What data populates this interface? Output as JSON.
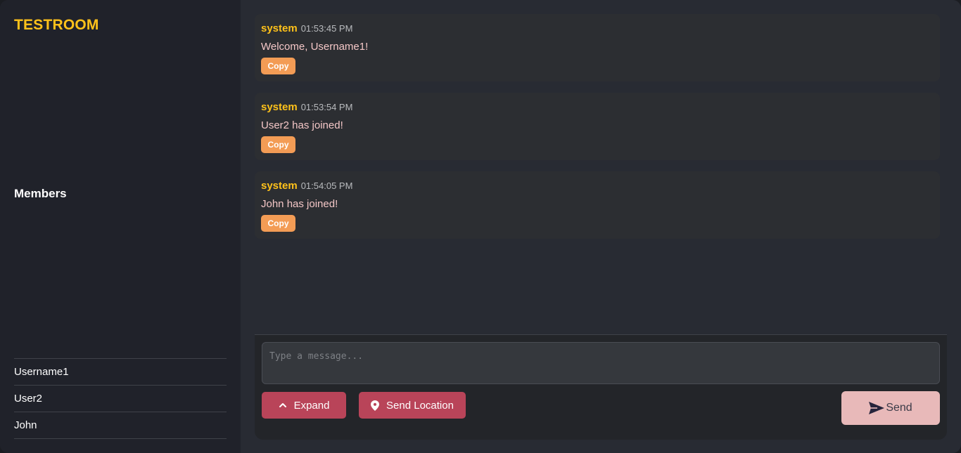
{
  "room": {
    "title": "TESTROOM"
  },
  "members": {
    "heading": "Members",
    "items": [
      "Username1",
      "User2",
      "John"
    ]
  },
  "messages": [
    {
      "sender": "system",
      "time": "01:53:45 PM",
      "text": "Welcome, Username1!",
      "copy_label": "Copy"
    },
    {
      "sender": "system",
      "time": "01:53:54 PM",
      "text": "User2 has joined!",
      "copy_label": "Copy"
    },
    {
      "sender": "system",
      "time": "01:54:05 PM",
      "text": "John has joined!",
      "copy_label": "Copy"
    }
  ],
  "composer": {
    "placeholder": "Type a message...",
    "expand_label": "Expand",
    "expand_icon": "chevron-up-icon",
    "location_label": "Send Location",
    "location_icon": "map-pin-icon",
    "send_label": "Send",
    "send_icon": "paper-plane-icon"
  },
  "colors": {
    "accent_yellow": "#ffc21a",
    "copy_orange": "#f39c55",
    "button_red": "#b94459",
    "send_pink": "#e8b9b9"
  }
}
